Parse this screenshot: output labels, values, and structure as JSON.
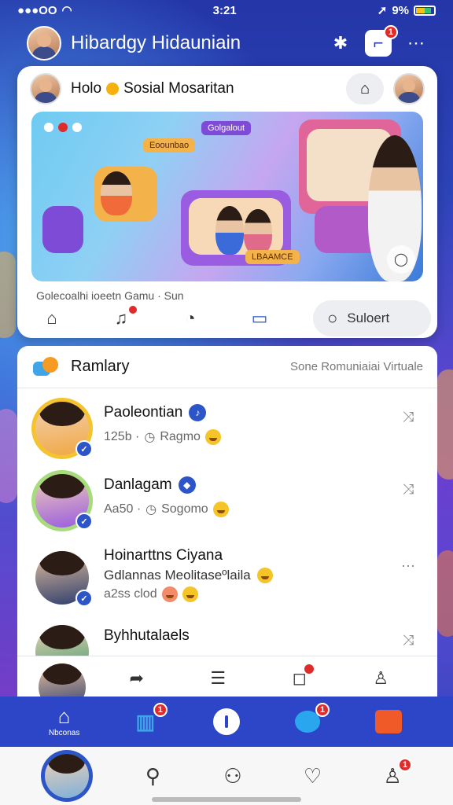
{
  "status_bar": {
    "carrier": "●●●OO",
    "time": "3:21",
    "battery": "9%"
  },
  "header": {
    "title": "Hibardgy Hidauniain",
    "notification_count": "1",
    "icons": [
      "avatar",
      "puzzle-icon",
      "square-bell-icon",
      "more-icon"
    ]
  },
  "post": {
    "title": "Holo",
    "title_rest": "Sosial Mosaritan",
    "caption": "Golecoalhi ioeetn Gamu · Sun",
    "hero_labels": [
      "Golgalout",
      "Eoounbao",
      "LBAAMCE"
    ],
    "actions": {
      "music_badge": ""
    },
    "search_label": "Suloert"
  },
  "panel": {
    "title": "Ramlary",
    "subtitle": "Sone Romuniaiai Virtuale",
    "items": [
      {
        "name": "Paoleontian",
        "meta": "125b ·",
        "meta_time": "Ragmo",
        "ring": "#f4c430"
      },
      {
        "name": "Danlagam",
        "meta": "Aa50 ·",
        "meta_time": "Sogomo",
        "ring": "#7fcf4e"
      },
      {
        "name": "Hoinarttns Ciyana",
        "line2": "Gdlannas Meolitaseºlaila",
        "line3": "a2ss clod",
        "ring": "#ffffff"
      },
      {
        "name": "Byhhutalaels",
        "ring": "#ffffff"
      }
    ]
  },
  "tabbar": {
    "home_label": "Nbconas",
    "badge_a": "1",
    "badge_b": "1"
  },
  "bottomnav": {
    "profile_badge": "1"
  },
  "colors": {
    "brand_blue": "#2d46c7",
    "badge_red": "#e02b2b",
    "accent_orange": "#f05a28"
  }
}
